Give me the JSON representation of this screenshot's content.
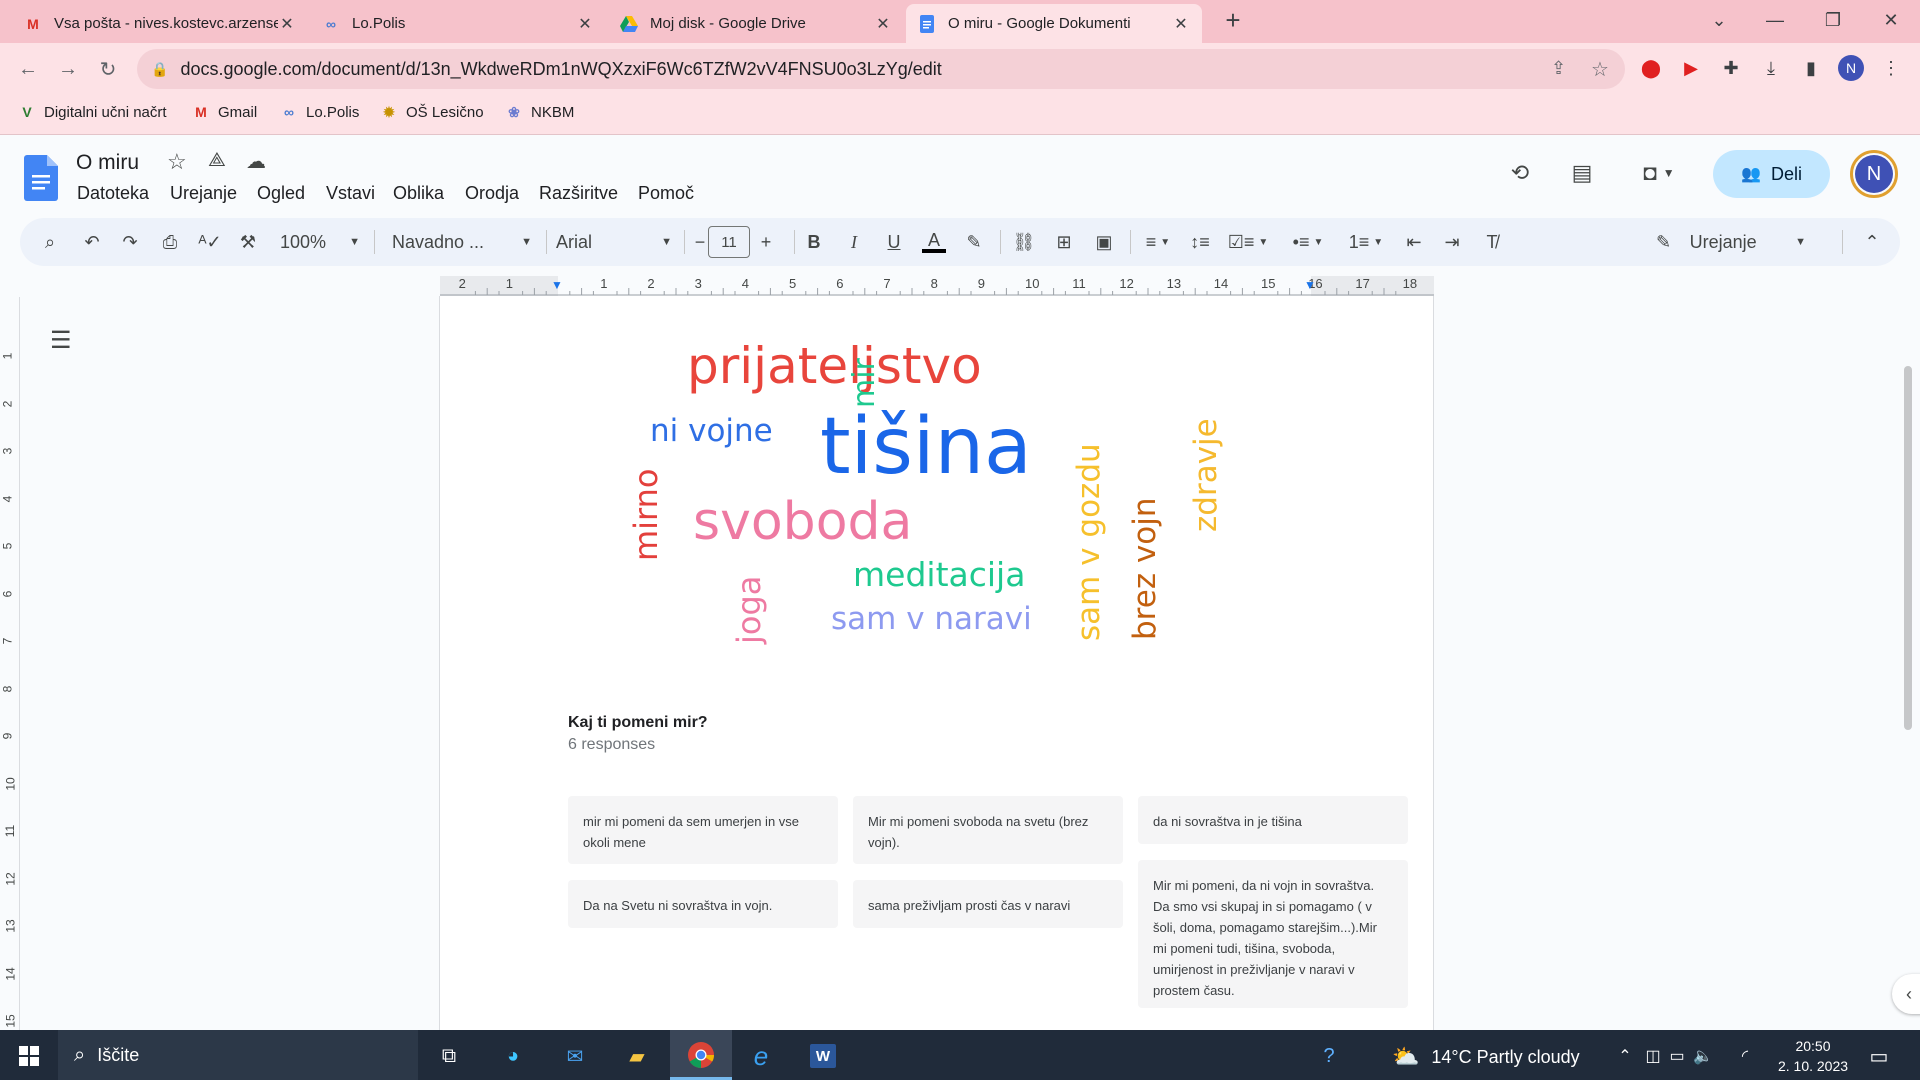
{
  "browser": {
    "tabs": [
      {
        "title": "Vsa pošta - nives.kostevc.arzensek",
        "icon": "gmail-icon"
      },
      {
        "title": "Lo.Polis",
        "icon": "lopolis-icon"
      },
      {
        "title": "Moj disk - Google Drive",
        "icon": "drive-icon"
      },
      {
        "title": "O miru - Google Dokumenti",
        "icon": "docs-icon",
        "active": true
      }
    ],
    "url": "docs.google.com/document/d/13n_WkdweRDm1nWQXzxiF6Wc6TZfW2vV4FNSU0o3LzYg/edit",
    "profile_initial": "N",
    "bookmarks": [
      {
        "label": "Digitalni učni načrt",
        "icon": "v-icon"
      },
      {
        "label": "Gmail",
        "icon": "gmail-icon"
      },
      {
        "label": "Lo.Polis",
        "icon": "lopolis-icon"
      },
      {
        "label": "OŠ Lesično",
        "icon": "school-icon"
      },
      {
        "label": "NKBM",
        "icon": "nkbm-icon"
      }
    ]
  },
  "docs": {
    "title": "O miru",
    "menu": [
      "Datoteka",
      "Urejanje",
      "Ogled",
      "Vstavi",
      "Oblika",
      "Orodja",
      "Razširitve",
      "Pomoč"
    ],
    "share_label": "Deli",
    "user_initial": "N",
    "toolbar": {
      "zoom": "100%",
      "style": "Navadno ...",
      "font": "Arial",
      "font_size": "11",
      "mode": "Urejanje"
    },
    "ruler_numbers": [
      "2",
      "1",
      "1",
      "2",
      "3",
      "4",
      "5",
      "6",
      "7",
      "8",
      "9",
      "10",
      "11",
      "12",
      "13",
      "14",
      "15",
      "16",
      "17",
      "18"
    ],
    "vruler_numbers": [
      "1",
      "2",
      "3",
      "4",
      "5",
      "6",
      "7",
      "8",
      "9",
      "10",
      "11",
      "12",
      "13",
      "14",
      "15"
    ]
  },
  "wordcloud": [
    {
      "text": "prijateljstvo",
      "color": "#e8453c"
    },
    {
      "text": "mir",
      "color": "#1ec98f"
    },
    {
      "text": "ni vojne",
      "color": "#2f6fe4"
    },
    {
      "text": "tišina",
      "color": "#1a66e8"
    },
    {
      "text": "zdravje",
      "color": "#f5b92e"
    },
    {
      "text": "mirno",
      "color": "#e3403c"
    },
    {
      "text": "sam v gozdu",
      "color": "#f6c02c"
    },
    {
      "text": "svoboda",
      "color": "#ee7aa2"
    },
    {
      "text": "brez vojn",
      "color": "#c2600f"
    },
    {
      "text": "meditacija",
      "color": "#1ec98f"
    },
    {
      "text": "joga",
      "color": "#ee7aa2"
    },
    {
      "text": "sam v naravi",
      "color": "#8d9af0"
    }
  ],
  "survey": {
    "question": "Kaj ti pomeni mir?",
    "responses_count": "6 responses",
    "responses": [
      "mir mi pomeni da sem umerjen in vse okoli mene",
      "Mir mi pomeni svoboda na svetu (brez vojn).",
      "da ni sovraštva in je tišina",
      "Da na Svetu ni sovraštva in vojn.",
      "sama preživljam prosti čas v naravi",
      "Mir mi pomeni, da ni vojn in sovraštva. Da smo vsi skupaj in si pomagamo ( v šoli, doma, pomagamo starejšim...).Mir mi pomeni tudi, tišina, svoboda, umirjenost in preživljanje v naravi v prostem času."
    ]
  },
  "taskbar": {
    "search_label": "Iščite",
    "weather": "14°C  Partly cloudy",
    "time": "20:50",
    "date": "2. 10. 2023"
  }
}
